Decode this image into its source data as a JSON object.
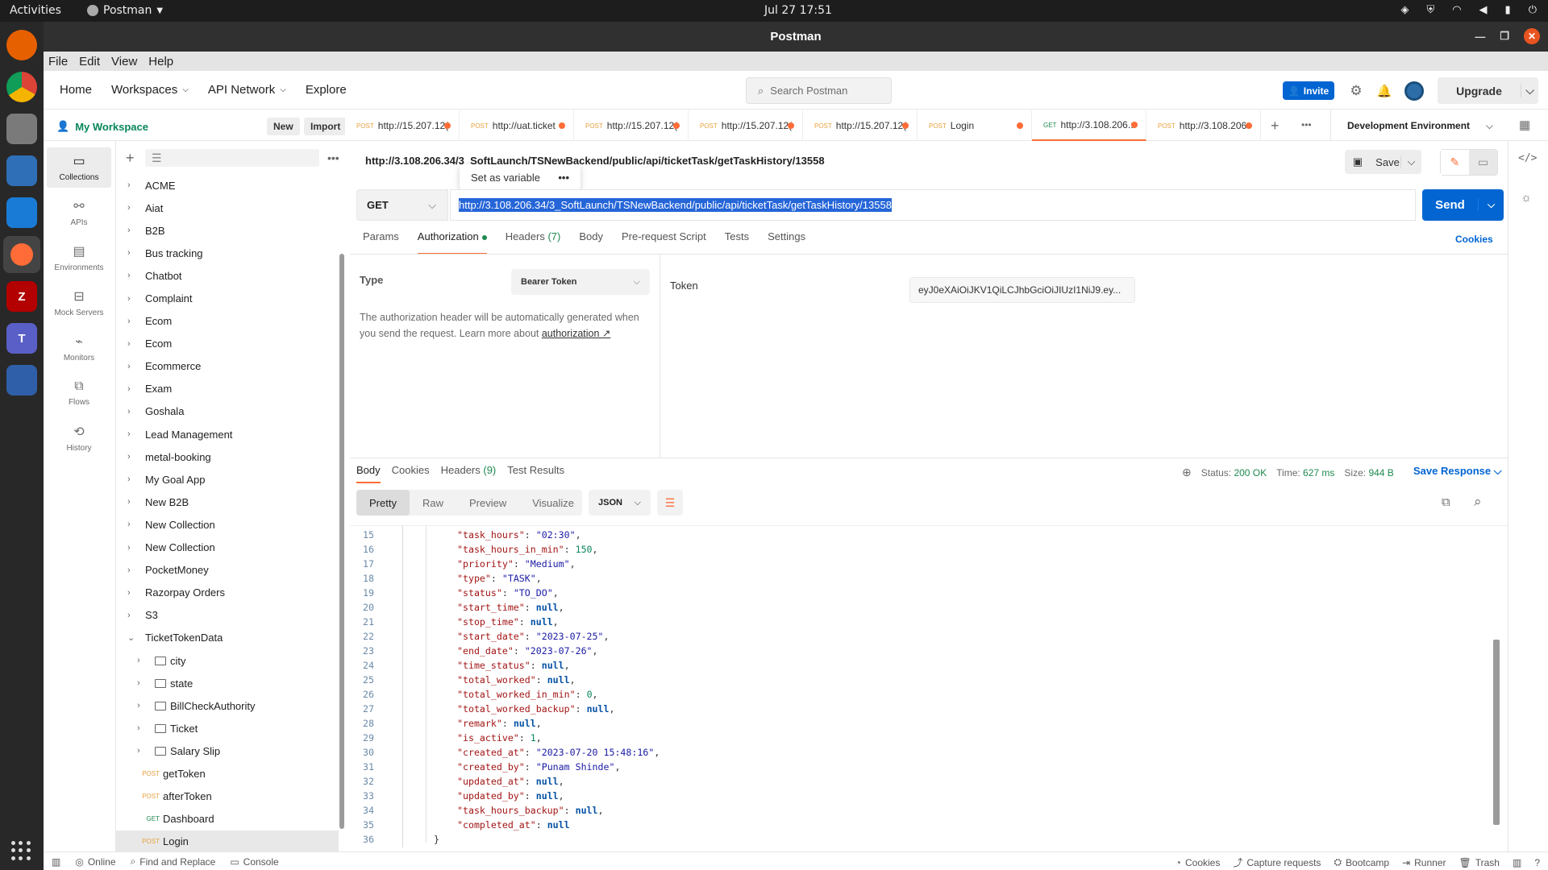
{
  "system": {
    "activities": "Activities",
    "app_name": "Postman",
    "clock": "Jul 27  17:51"
  },
  "window": {
    "title": "Postman"
  },
  "menubar": [
    "File",
    "Edit",
    "View",
    "Help"
  ],
  "header": {
    "nav": [
      "Home",
      "Workspaces",
      "API Network",
      "Explore"
    ],
    "search_placeholder": "Search Postman",
    "invite": "Invite",
    "upgrade": "Upgrade"
  },
  "workspace": {
    "name": "My Workspace",
    "new": "New",
    "import": "Import"
  },
  "rail": [
    "Collections",
    "APIs",
    "Environments",
    "Mock Servers",
    "Monitors",
    "Flows",
    "History"
  ],
  "collections": [
    "ACME",
    "Aiat",
    "B2B",
    "Bus tracking",
    "Chatbot",
    "Complaint",
    "Ecom",
    "Ecom",
    "Ecommerce",
    "Exam",
    "Goshala",
    "Lead Management",
    "metal-booking",
    "My Goal App",
    "New B2B",
    "New Collection",
    "New Collection",
    "PocketMoney",
    "Razorpay Orders",
    "S3",
    "TicketTokenData"
  ],
  "folders": [
    "city",
    "state",
    "BillCheckAuthority",
    "Ticket",
    "Salary Slip"
  ],
  "requests": [
    {
      "method": "POST",
      "name": "getToken"
    },
    {
      "method": "POST",
      "name": "afterToken"
    },
    {
      "method": "GET",
      "name": "Dashboard"
    },
    {
      "method": "POST",
      "name": "Login"
    }
  ],
  "tabs": [
    {
      "method": "POST",
      "label": "http://15.207.12("
    },
    {
      "method": "POST",
      "label": "http://uat.ticket"
    },
    {
      "method": "POST",
      "label": "http://15.207.12("
    },
    {
      "method": "POST",
      "label": "http://15.207.12("
    },
    {
      "method": "POST",
      "label": "http://15.207.12("
    },
    {
      "method": "POST",
      "label": "Login"
    },
    {
      "method": "GET",
      "label": "http://3.108.206.:"
    },
    {
      "method": "POST",
      "label": "http://3.108.206"
    }
  ],
  "environment": "Development Environment",
  "request": {
    "title": "http://3.108.206.34/3_SoftLaunch/TSNewBackend/public/api/ticketTask/getTaskHistory/13558",
    "method": "GET",
    "url": "http://3.108.206.34/3_SoftLaunch/TSNewBackend/public/api/ticketTask/getTaskHistory/13558",
    "save": "Save",
    "send": "Send",
    "popover": "Set as variable",
    "tabs": {
      "params": "Params",
      "auth": "Authorization",
      "headers": "Headers",
      "headers_count": "(7)",
      "body": "Body",
      "pre": "Pre-request Script",
      "tests": "Tests",
      "settings": "Settings"
    },
    "cookies": "Cookies"
  },
  "auth": {
    "type_label": "Type",
    "type_value": "Bearer Token",
    "note": "The authorization header will be automatically generated when you send the request. Learn more about ",
    "note_link": "authorization ↗",
    "token_label": "Token",
    "token_value": "eyJ0eXAiOiJKV1QiLCJhbGciOiJIUzI1NiJ9.ey..."
  },
  "response": {
    "tabs": [
      "Body",
      "Cookies",
      "Headers",
      "Test Results"
    ],
    "headers_count": "(9)",
    "status_label": "Status:",
    "status": "200 OK",
    "time_label": "Time:",
    "time": "627 ms",
    "size_label": "Size:",
    "size": "944 B",
    "save_response": "Save Response",
    "views": [
      "Pretty",
      "Raw",
      "Preview",
      "Visualize"
    ],
    "format": "JSON",
    "lines": [
      {
        "n": "15",
        "k": "task_hours",
        "v": "\"02:30\"",
        "t": "s"
      },
      {
        "n": "16",
        "k": "task_hours_in_min",
        "v": "150",
        "t": "n"
      },
      {
        "n": "17",
        "k": "priority",
        "v": "\"Medium\"",
        "t": "s"
      },
      {
        "n": "18",
        "k": "type",
        "v": "\"TASK\"",
        "t": "s"
      },
      {
        "n": "19",
        "k": "status",
        "v": "\"TO_DO\"",
        "t": "s"
      },
      {
        "n": "20",
        "k": "start_time",
        "v": "null",
        "t": "nl"
      },
      {
        "n": "21",
        "k": "stop_time",
        "v": "null",
        "t": "nl"
      },
      {
        "n": "22",
        "k": "start_date",
        "v": "\"2023-07-25\"",
        "t": "s"
      },
      {
        "n": "23",
        "k": "end_date",
        "v": "\"2023-07-26\"",
        "t": "s"
      },
      {
        "n": "24",
        "k": "time_status",
        "v": "null",
        "t": "nl"
      },
      {
        "n": "25",
        "k": "total_worked",
        "v": "null",
        "t": "nl"
      },
      {
        "n": "26",
        "k": "total_worked_in_min",
        "v": "0",
        "t": "n"
      },
      {
        "n": "27",
        "k": "total_worked_backup",
        "v": "null",
        "t": "nl"
      },
      {
        "n": "28",
        "k": "remark",
        "v": "null",
        "t": "nl"
      },
      {
        "n": "29",
        "k": "is_active",
        "v": "1",
        "t": "n"
      },
      {
        "n": "30",
        "k": "created_at",
        "v": "\"2023-07-20 15:48:16\"",
        "t": "s"
      },
      {
        "n": "31",
        "k": "created_by",
        "v": "\"Punam Shinde\"",
        "t": "s"
      },
      {
        "n": "32",
        "k": "updated_at",
        "v": "null",
        "t": "nl"
      },
      {
        "n": "33",
        "k": "updated_by",
        "v": "null",
        "t": "nl"
      },
      {
        "n": "34",
        "k": "task_hours_backup",
        "v": "null",
        "t": "nl"
      },
      {
        "n": "35",
        "k": "completed_at",
        "v": "null",
        "t": "nl",
        "last": true
      }
    ],
    "closing": {
      "n": "36",
      "text": "}"
    }
  },
  "statusbar": {
    "online": "Online",
    "find": "Find and Replace",
    "console": "Console",
    "cookies": "Cookies",
    "capture": "Capture requests",
    "bootcamp": "Bootcamp",
    "runner": "Runner",
    "trash": "Trash"
  }
}
